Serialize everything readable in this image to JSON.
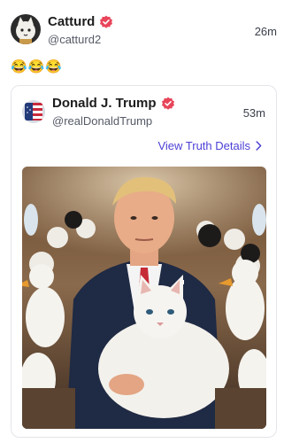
{
  "post": {
    "author": {
      "display_name": "Catturd",
      "handle": "@catturd2",
      "verified": true
    },
    "time": "26m",
    "text": "😂😂😂"
  },
  "quoted_post": {
    "author": {
      "display_name": "Donald J. Trump",
      "handle": "@realDonaldTrump",
      "verified": true
    },
    "time": "53m",
    "details_link_label": "View Truth Details",
    "image": {
      "icon": "photo"
    }
  },
  "colors": {
    "accent": "#4c3fd6",
    "verified_badge": "#e8455a",
    "handle_gray": "#555a66",
    "card_border": "#e3e5ea"
  }
}
